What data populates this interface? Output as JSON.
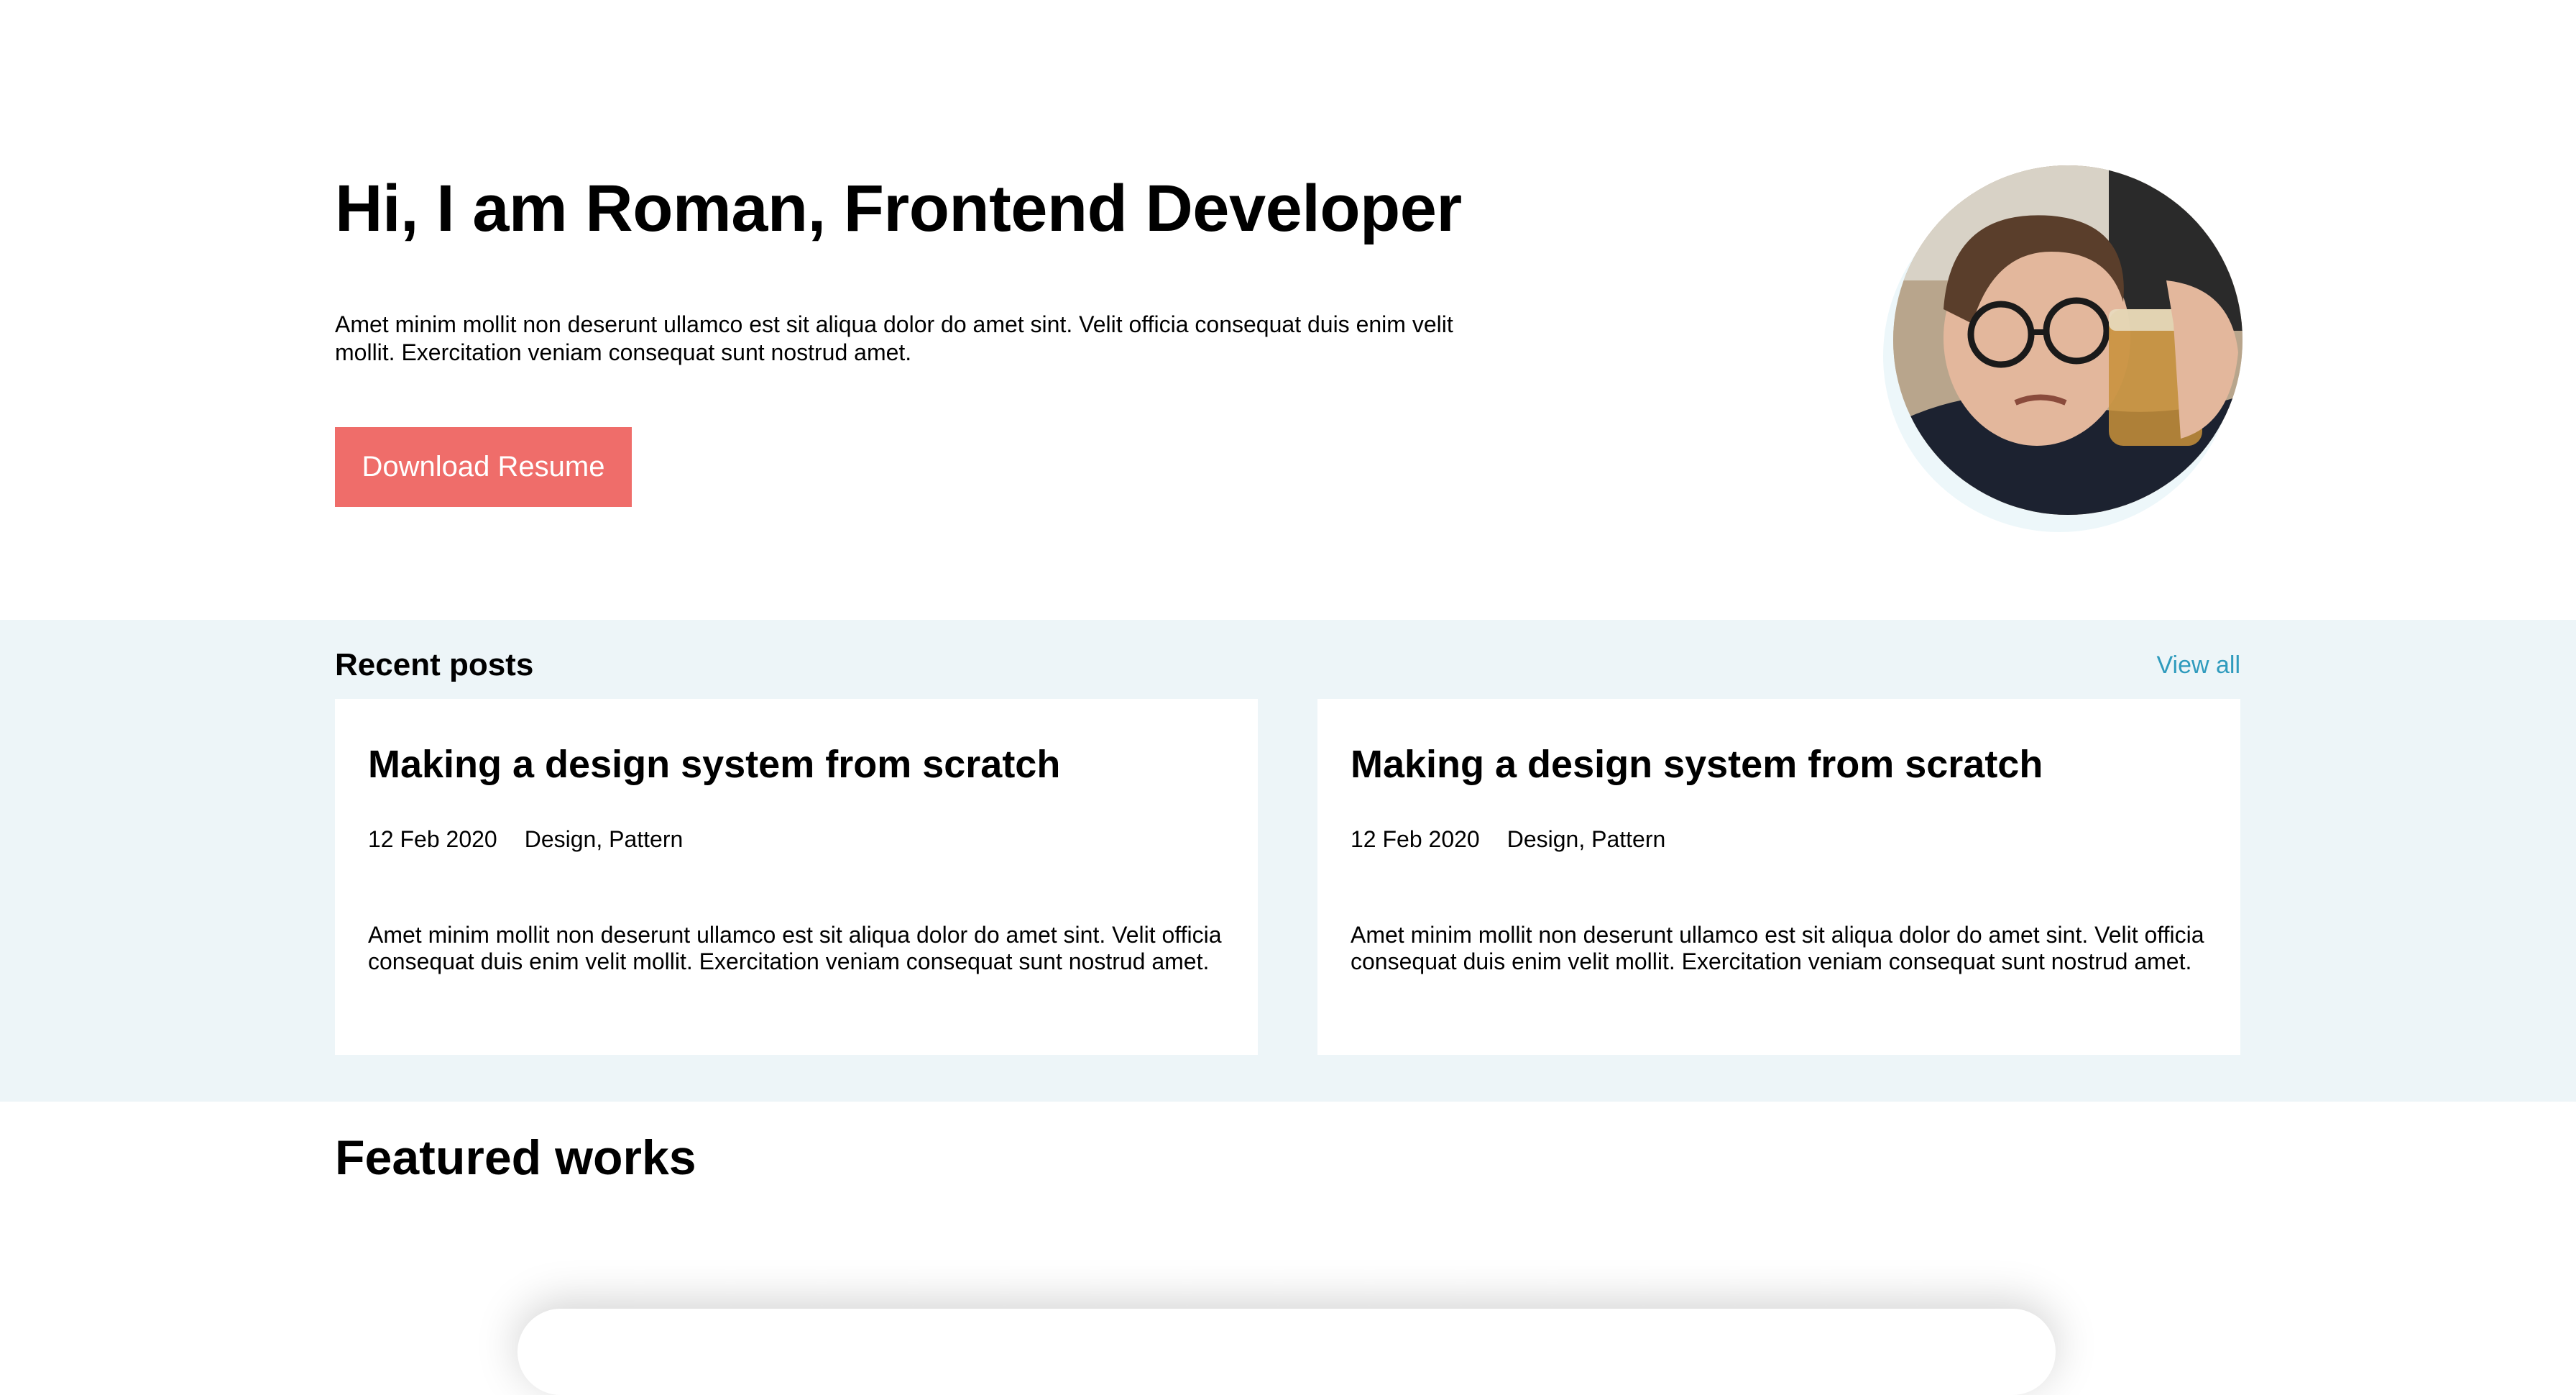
{
  "hero": {
    "title": "Hi, I am Roman, Frontend Developer",
    "description": "Amet minim mollit non deserunt ullamco est sit aliqua dolor do amet sint. Velit officia consequat duis enim velit mollit. Exercitation veniam consequat sunt nostrud amet.",
    "button_label": "Download Resume",
    "button_color": "#ef6d6a"
  },
  "recent_posts": {
    "heading": "Recent posts",
    "view_all_label": "View all",
    "link_color": "#2f9bbd",
    "background": "#edf5f8",
    "posts": [
      {
        "title": "Making a design system from scratch",
        "date": "12 Feb 2020",
        "tags": "Design, Pattern",
        "excerpt": "Amet minim mollit non deserunt ullamco est sit aliqua dolor do amet sint. Velit officia consequat duis enim velit mollit. Exercitation veniam consequat sunt nostrud amet."
      },
      {
        "title": "Making a design system from scratch",
        "date": "12 Feb 2020",
        "tags": "Design, Pattern",
        "excerpt": "Amet minim mollit non deserunt ullamco est sit aliqua dolor do amet sint. Velit officia consequat duis enim velit mollit. Exercitation veniam consequat sunt nostrud amet."
      }
    ]
  },
  "featured": {
    "heading": "Featured works"
  }
}
